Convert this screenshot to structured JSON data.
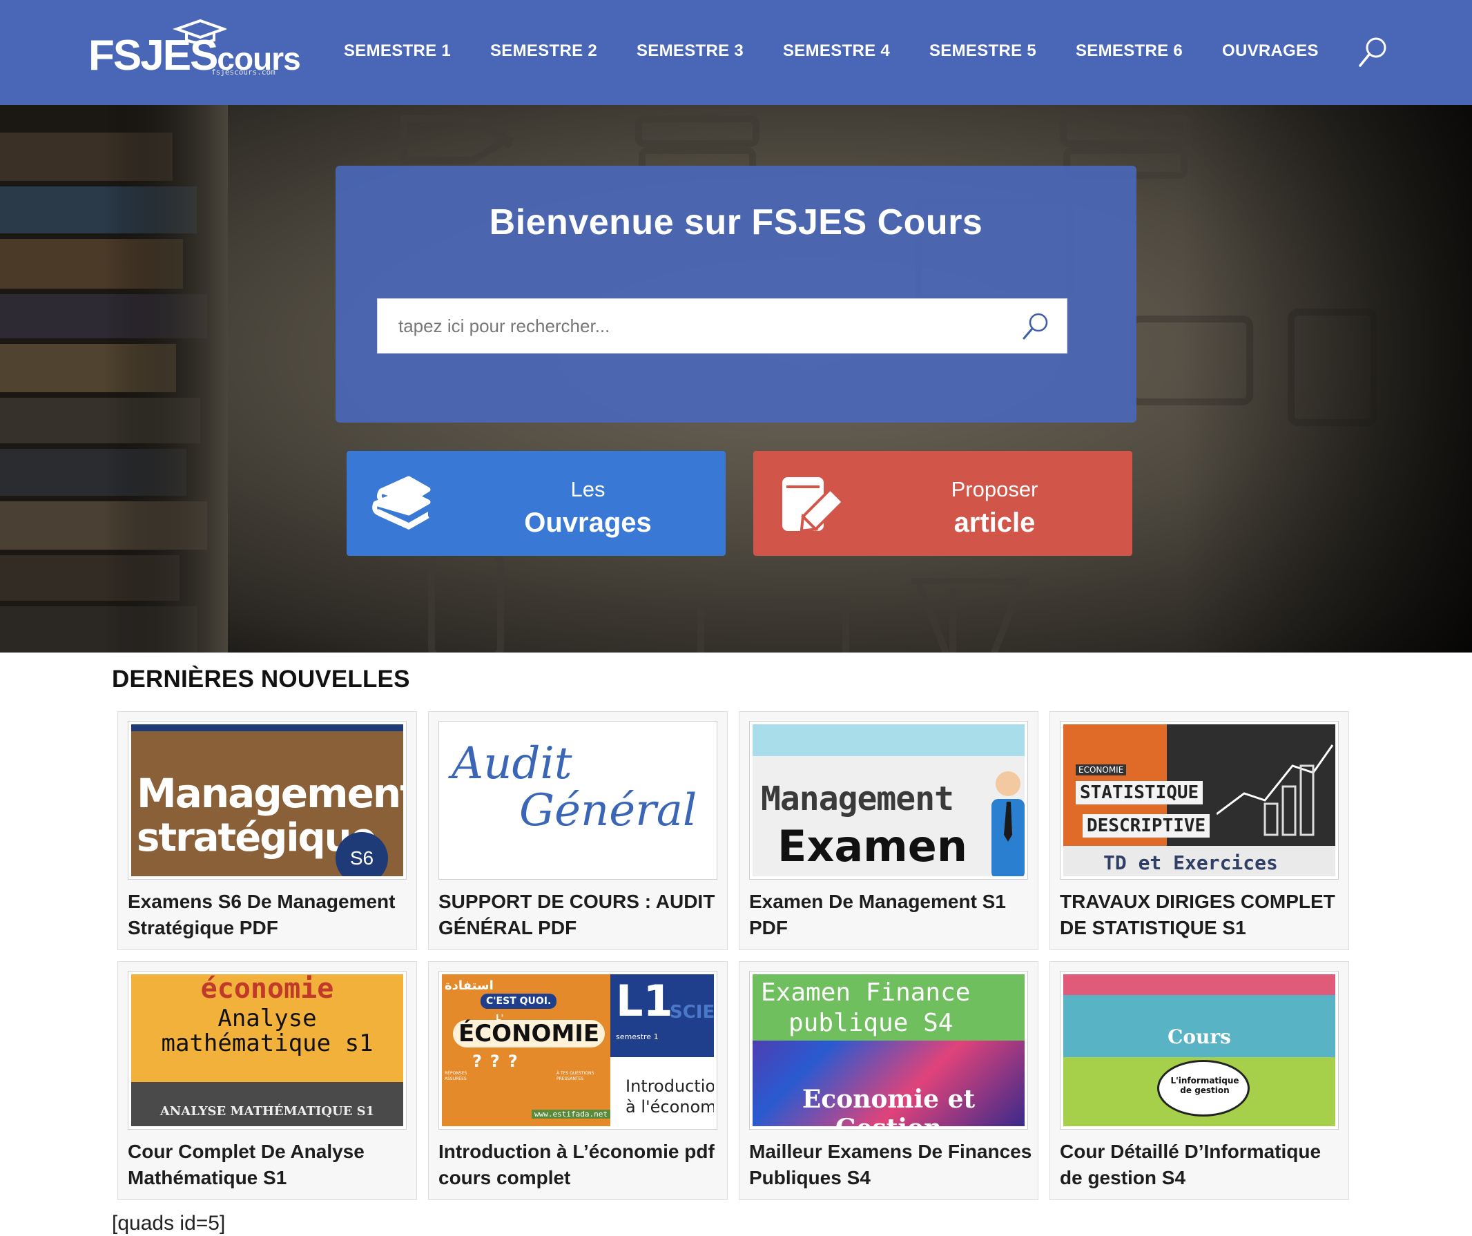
{
  "header": {
    "logo_text_main": "FSJES",
    "logo_text_small": "cours",
    "logo_domain": "fsjescours.com",
    "nav": [
      {
        "label": "SEMESTRE 1"
      },
      {
        "label": "SEMESTRE 2"
      },
      {
        "label": "SEMESTRE 3"
      },
      {
        "label": "SEMESTRE 4"
      },
      {
        "label": "SEMESTRE 5"
      },
      {
        "label": "SEMESTRE 6"
      },
      {
        "label": "OUVRAGES"
      }
    ],
    "search_icon": "search-icon"
  },
  "hero": {
    "title": "Bienvenue sur FSJES Cours",
    "search_placeholder": "tapez ici pour rechercher...",
    "search_value": "",
    "ctas": [
      {
        "small": "Les",
        "big": "Ouvrages",
        "icon": "books-icon",
        "color": "#3a78d6"
      },
      {
        "small": "Proposer",
        "big": "article",
        "icon": "edit-document-icon",
        "color": "#d2554a"
      }
    ]
  },
  "news": {
    "heading": "DERNIÈRES NOUVELLES",
    "cards": [
      {
        "title": "Examens S6 De Management Stratégique PDF",
        "thumb_lines": [
          "Management",
          "stratégique",
          "S6"
        ]
      },
      {
        "title": "SUPPORT DE COURS : AUDIT GÉNÉRAL PDF",
        "thumb_lines": [
          "Audit",
          "Général"
        ]
      },
      {
        "title": "Examen De Management S1 PDF",
        "thumb_lines": [
          "Management",
          "Examen"
        ]
      },
      {
        "title": "TRAVAUX DIRIGES COMPLET DE STATISTIQUE S1",
        "thumb_lines": [
          "ECONOMIE",
          "STATISTIQUE",
          "DESCRIPTIVE",
          "TD et Exercices"
        ]
      },
      {
        "title": "Cour Complet De Analyse Mathématique S1",
        "thumb_lines": [
          "économie",
          "Analyse",
          "mathématique s1",
          "ANALYSE MATHÉMATIQUE S1"
        ]
      },
      {
        "title": "Introduction à L’économie pdf cours complet",
        "thumb_lines": [
          "استفادة",
          "C'EST QUOI.",
          "L'",
          "ÉCONOMIE",
          "?",
          "L1",
          "SCIE",
          "semestre 1",
          "Introductio",
          "à l'économi",
          "RÉPONSES ASSURÉES",
          "À TES QUESTIONS PRESSANTES",
          "www.estifada.net"
        ]
      },
      {
        "title": "Mailleur Examens De Finances Publiques  S4",
        "thumb_lines": [
          "Examen Finance",
          "publique S4",
          "Economie et Gestion"
        ]
      },
      {
        "title": "Cour Détaillé D’Informatique de gestion S4",
        "thumb_lines": [
          "Cours",
          "L'informatique de gestion"
        ]
      }
    ]
  },
  "footer_shortcode": "[quads id=5]",
  "colors": {
    "header_bg": "#4a67b7",
    "cta_blue": "#3a78d6",
    "cta_red": "#d2554a"
  }
}
